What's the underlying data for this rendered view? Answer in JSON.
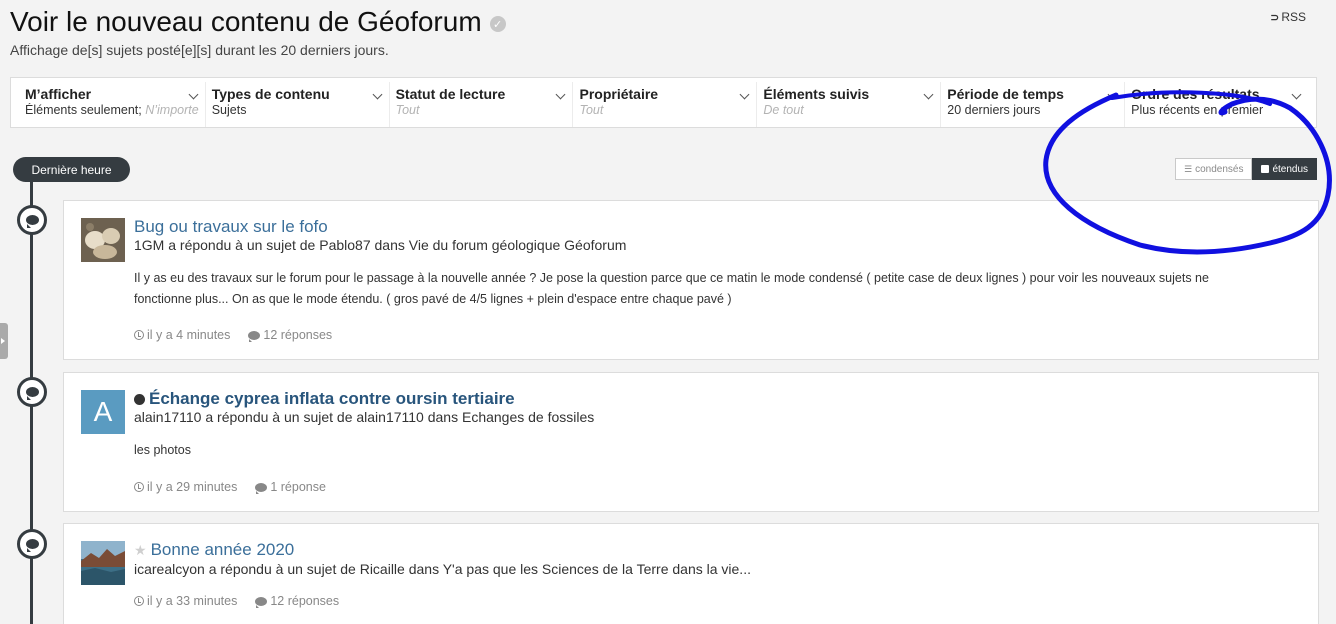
{
  "header": {
    "title": "Voir le nouveau contenu de Géoforum",
    "subtitle": "Affichage de[s] sujets posté[e][s] durant les 20 derniers jours.",
    "rss_label": "RSS"
  },
  "filters": [
    {
      "label": "M’afficher",
      "value": "Éléments seulement;",
      "value_muted": " N’importe",
      "muted": false
    },
    {
      "label": "Types de contenu",
      "value": "Sujets",
      "muted": false
    },
    {
      "label": "Statut de lecture",
      "value": "Tout",
      "muted": true
    },
    {
      "label": "Propriétaire",
      "value": "Tout",
      "muted": true
    },
    {
      "label": "Éléments suivis",
      "value": "De tout",
      "muted": true
    },
    {
      "label": "Période de temps",
      "value": "20 derniers jours",
      "muted": false
    },
    {
      "label": "Ordre des résultats",
      "value": "Plus récents en premier",
      "muted": false
    }
  ],
  "timeline": {
    "label": "Dernière heure"
  },
  "view_toggle": {
    "condensed": "condensés",
    "expanded": "étendus",
    "active": "expanded"
  },
  "posts": [
    {
      "title": "Bug ou travaux sur le fofo",
      "meta": "1GM a répondu à un sujet de Pablo87 dans Vie du forum géologique Géoforum",
      "snippet": "Il y as eu des travaux sur le forum pour le passage à la nouvelle année ? Je pose la question parce que ce matin le mode condensé ( petite case de deux lignes ) pour voir les nouveaux sujets ne fonctionne plus... On as que le mode étendu. ( gros pavé de 4/5 lignes + plein d'espace entre chaque pavé )",
      "time": "il y a 4 minutes",
      "replies": "12 réponses"
    },
    {
      "title": "Échange cyprea inflata contre oursin tertiaire",
      "avatar_letter": "A",
      "meta": "alain17110 a répondu à un sujet de alain17110 dans Echanges de fossiles",
      "snippet": "les photos",
      "time": "il y a 29 minutes",
      "replies": "1 réponse"
    },
    {
      "title": "Bonne année 2020",
      "meta": "icarealcyon a répondu à un sujet de Ricaille dans Y'a pas que les Sciences de la Terre dans la vie...",
      "time": "il y a 33 minutes",
      "replies": "12 réponses"
    }
  ],
  "colors": {
    "accent": "#353c41",
    "link": "#3b6f9a",
    "annotation": "#1010e0"
  }
}
